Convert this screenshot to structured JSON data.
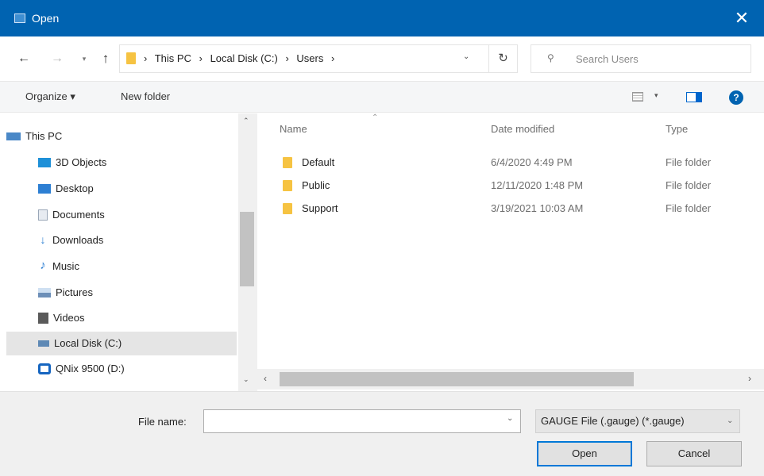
{
  "window": {
    "title": "Open",
    "close_glyph": "✕"
  },
  "address": {
    "back_glyph": "←",
    "forward_glyph": "→",
    "recent_glyph": "▾",
    "up_glyph": "↑",
    "crumbs": [
      "›",
      "This PC",
      "›",
      "Local Disk (C:)",
      "›",
      "Users",
      "›"
    ],
    "dropdown_glyph": "⌄",
    "refresh_glyph": "↻",
    "search_placeholder": "Search Users"
  },
  "toolbar": {
    "organize_label": "Organize ▾",
    "new_folder_label": "New folder",
    "view_dropdown_glyph": "▾",
    "help_glyph": "?"
  },
  "nav_pane": {
    "items": [
      {
        "label": "This PC",
        "icon": "this-pc-icon",
        "color": "#4a88c7"
      },
      {
        "label": "3D Objects",
        "icon": "3d-objects-icon",
        "color": "#1e90d8"
      },
      {
        "label": "Desktop",
        "icon": "desktop-icon",
        "color": "#2d7fd3"
      },
      {
        "label": "Documents",
        "icon": "documents-icon",
        "color": "#9aa7b8"
      },
      {
        "label": "Downloads",
        "icon": "downloads-icon",
        "color": "#2d7fd3"
      },
      {
        "label": "Music",
        "icon": "music-icon",
        "color": "#2d7fd3"
      },
      {
        "label": "Pictures",
        "icon": "pictures-icon",
        "color": "#6d8fb8"
      },
      {
        "label": "Videos",
        "icon": "videos-icon",
        "color": "#5a5a5a"
      },
      {
        "label": "Local Disk (C:)",
        "icon": "local-disk-icon",
        "color": "#5e89b5",
        "selected": true
      },
      {
        "label": "QNix 9500  (D:)",
        "icon": "drive-d-icon",
        "color": "#1565c0"
      }
    ]
  },
  "file_pane": {
    "columns": {
      "name": "Name",
      "date_modified": "Date modified",
      "type": "Type"
    },
    "sort_caret": "⌃",
    "rows": [
      {
        "name": "Default",
        "date": "6/4/2020 4:49 PM",
        "type": "File folder"
      },
      {
        "name": "Public",
        "date": "12/11/2020 1:48 PM",
        "type": "File folder"
      },
      {
        "name": "Support",
        "date": "3/19/2021 10:03 AM",
        "type": "File folder"
      }
    ]
  },
  "scroll": {
    "up_glyph": "⌃",
    "down_glyph": "⌄",
    "left_glyph": "‹",
    "right_glyph": "›"
  },
  "footer": {
    "file_name_label": "File name:",
    "file_name_value": "",
    "file_name_dropdown_glyph": "⌄",
    "filter_value": "GAUGE File (.gauge) (*.gauge)",
    "filter_dropdown_glyph": "⌄",
    "open_label": "Open",
    "cancel_label": "Cancel"
  },
  "colors": {
    "titlebar": "#0063b1",
    "folder": "#f6c342",
    "selection": "#e5e5e5",
    "default_button_border": "#0078d7"
  }
}
